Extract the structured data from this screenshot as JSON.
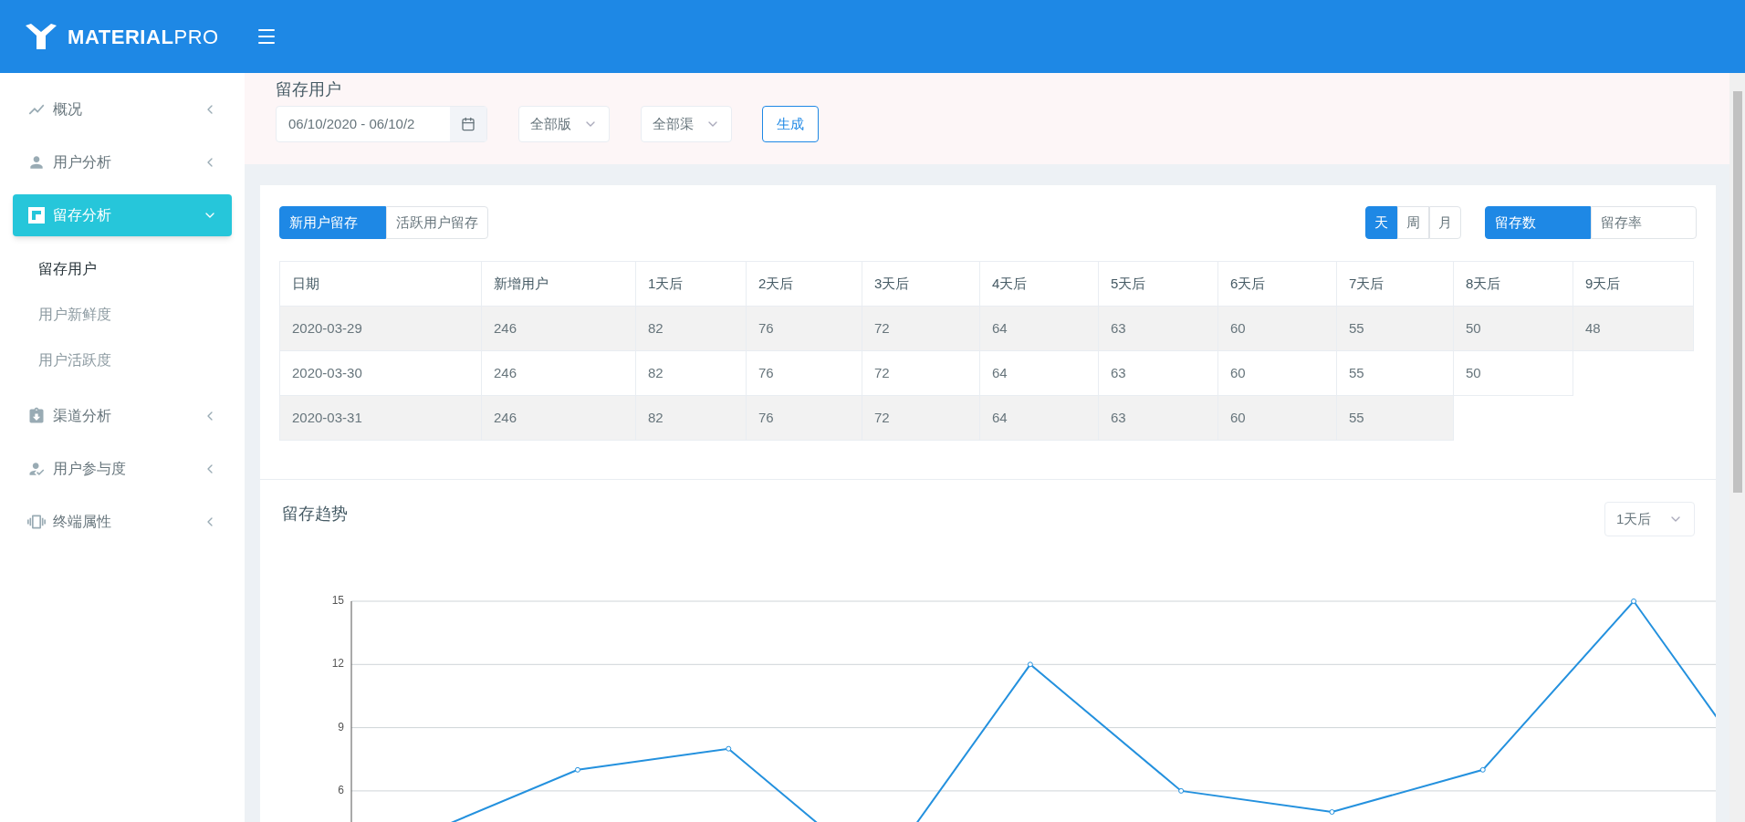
{
  "brand": {
    "name": "**MATERIAL**PRO"
  },
  "sidebar": {
    "items": [
      {
        "label": "概况",
        "expanded": false,
        "selected": false
      },
      {
        "label": "用户分析",
        "expanded": false,
        "selected": false
      },
      {
        "label": "留存分析",
        "expanded": true,
        "selected": true,
        "children": [
          {
            "label": "留存用户",
            "selected": true
          },
          {
            "label": "用户新鲜度",
            "selected": false
          },
          {
            "label": "用户活跃度",
            "selected": false
          }
        ]
      },
      {
        "label": "渠道分析",
        "expanded": false,
        "selected": false
      },
      {
        "label": "用户参与度",
        "expanded": false,
        "selected": false
      },
      {
        "label": "终端属性",
        "expanded": false,
        "selected": false
      }
    ]
  },
  "page_header": {
    "title": "留存用户",
    "date_range": {
      "value": "06/10/2020 - 06/10/2"
    },
    "version_select": {
      "value": "全部版"
    },
    "channel_select": {
      "value": "全部渠"
    },
    "generate_button": "生成"
  },
  "user_type_tabs": [
    {
      "label": "新用户留存",
      "selected": true
    },
    {
      "label": "活跃用户留存",
      "selected": false
    }
  ],
  "period_tabs": [
    {
      "label": "天",
      "selected": true
    },
    {
      "label": "周",
      "selected": false
    },
    {
      "label": "月",
      "selected": false
    }
  ],
  "metric_tabs": [
    {
      "label": "留存数",
      "selected": true
    },
    {
      "label": "留存率",
      "selected": false
    }
  ],
  "table": {
    "columns": [
      "日期",
      "新增用户",
      "1天后",
      "2天后",
      "3天后",
      "4天后",
      "5天后",
      "6天后",
      "7天后",
      "8天后",
      "9天后"
    ],
    "rows": [
      [
        "2020-03-29",
        "246",
        "82",
        "76",
        "72",
        "64",
        "63",
        "60",
        "55",
        "50",
        "48"
      ],
      [
        "2020-03-30",
        "246",
        "82",
        "76",
        "72",
        "64",
        "63",
        "60",
        "55",
        "50"
      ],
      [
        "2020-03-31",
        "246",
        "82",
        "76",
        "72",
        "64",
        "63",
        "60",
        "55"
      ]
    ]
  },
  "trend": {
    "title": "留存趋势",
    "day_select": {
      "value": "1天后"
    },
    "chart_data": {
      "type": "line",
      "ylim": [
        0,
        15
      ],
      "grid": true,
      "yticks": [
        6,
        9,
        12,
        15
      ],
      "series": [
        {
          "color": "#2491de",
          "marker": "circle",
          "values": [
            4,
            7,
            8,
            2,
            12,
            6,
            5,
            7,
            15,
            5
          ]
        }
      ]
    }
  }
}
